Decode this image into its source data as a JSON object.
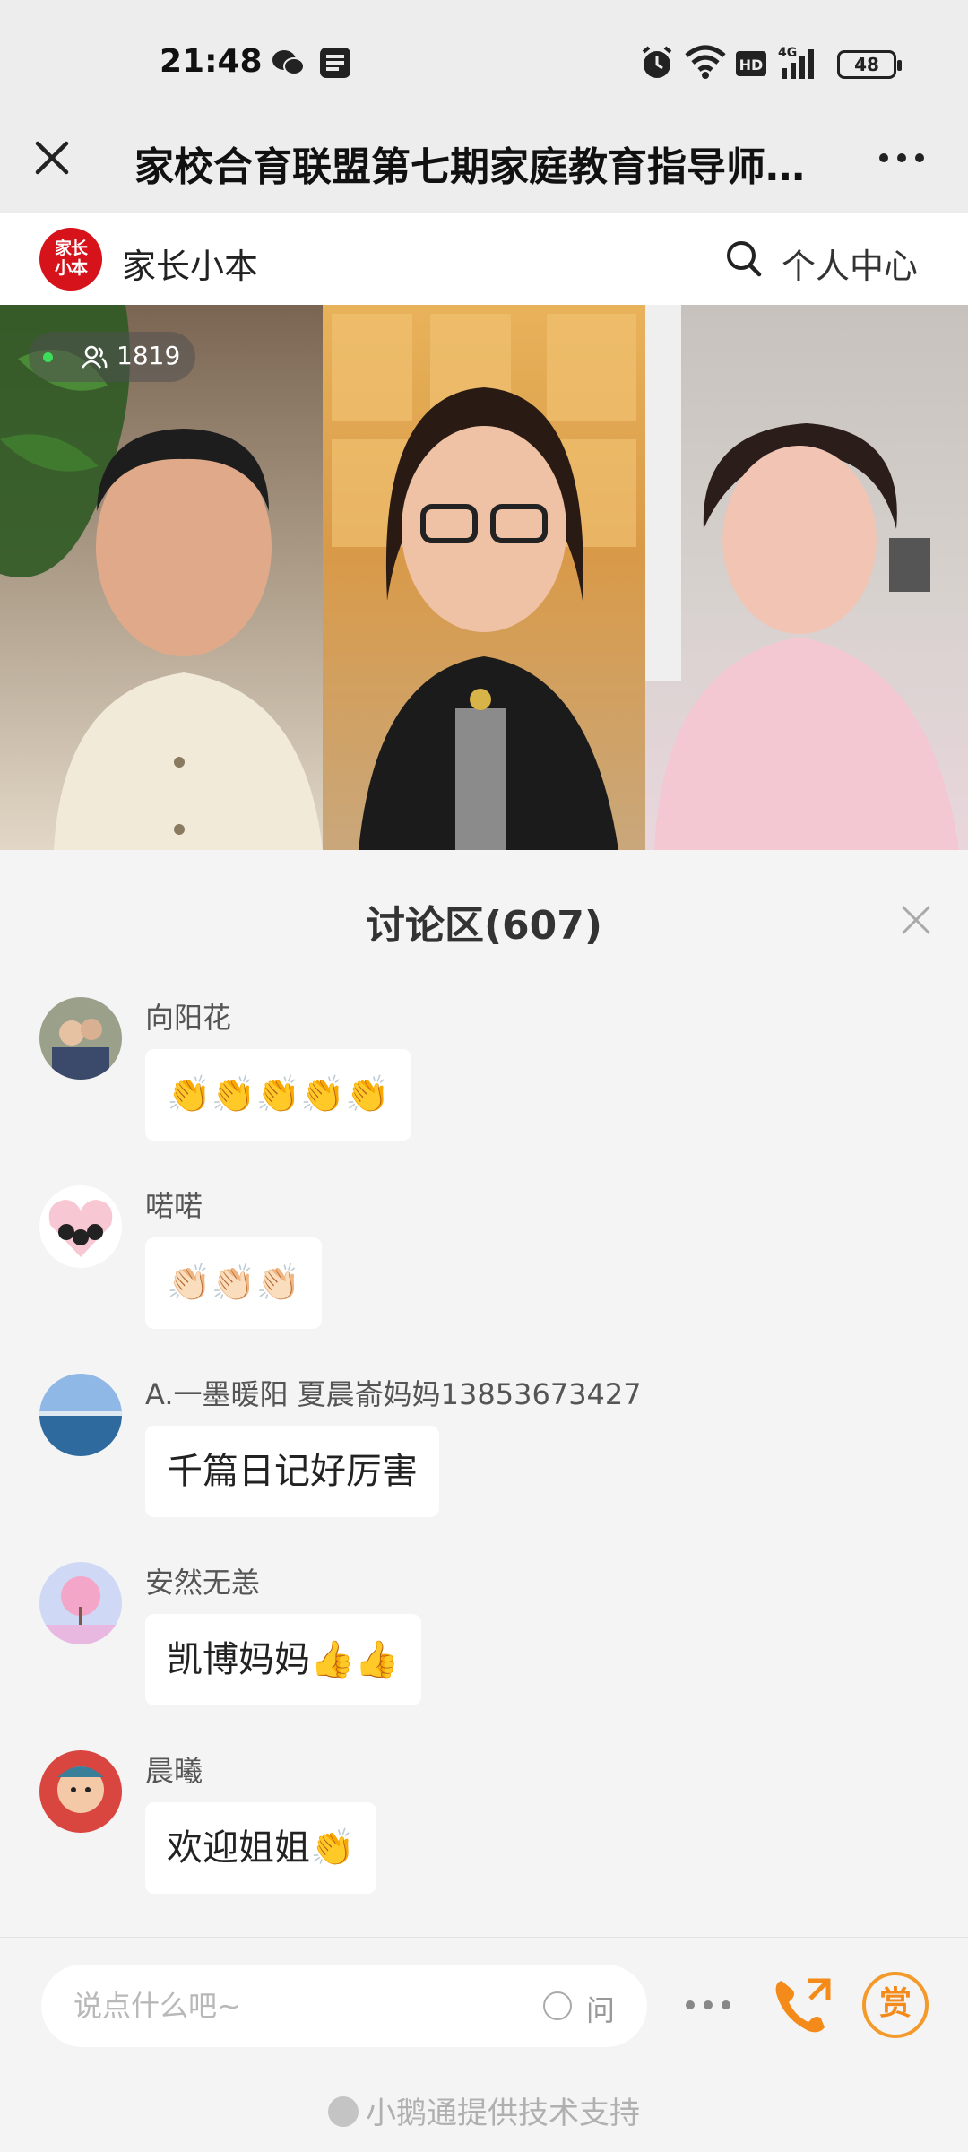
{
  "status_bar": {
    "time": "21:48",
    "network": "4G",
    "hd_label": "HD",
    "battery": "48",
    "icons": [
      "wechat-icon",
      "app-icon",
      "alarm-icon",
      "wifi-icon",
      "hd-icon",
      "signal-icon",
      "battery-icon"
    ]
  },
  "title_bar": {
    "title": "家校合育联盟第七期家庭教育指导师…",
    "icons": [
      "close-icon",
      "more-icon"
    ]
  },
  "brand": {
    "logo_text": "家长小本",
    "name": "家长小本",
    "personal_center": "个人中心",
    "icons": [
      "search-icon"
    ]
  },
  "video": {
    "viewer_count": "1819",
    "icons": [
      "people-icon"
    ]
  },
  "discussion": {
    "title": "讨论区(607)",
    "messages": [
      {
        "sender": "向阳花",
        "text": "👏👏👏👏👏"
      },
      {
        "sender": "喏喏",
        "text": "👏🏻👏🏻👏🏻"
      },
      {
        "sender": "A.一墨暖阳 夏晨嵛妈妈13853673427",
        "text": "千篇日记好厉害"
      },
      {
        "sender": "安然无恙",
        "text": "凯博妈妈👍👍"
      },
      {
        "sender": "晨曦",
        "text": "欢迎姐姐👏"
      }
    ]
  },
  "input_bar": {
    "placeholder": "说点什么吧~",
    "ask_label": "问",
    "reward_label": "赏",
    "powered_by": "小鹅通提供技术支持",
    "icons": [
      "more-dots-icon",
      "phone-icon"
    ]
  },
  "colors": {
    "brand_red": "#d6121b",
    "accent_orange": "#f38a1a",
    "live_green": "#3ddc5a"
  }
}
